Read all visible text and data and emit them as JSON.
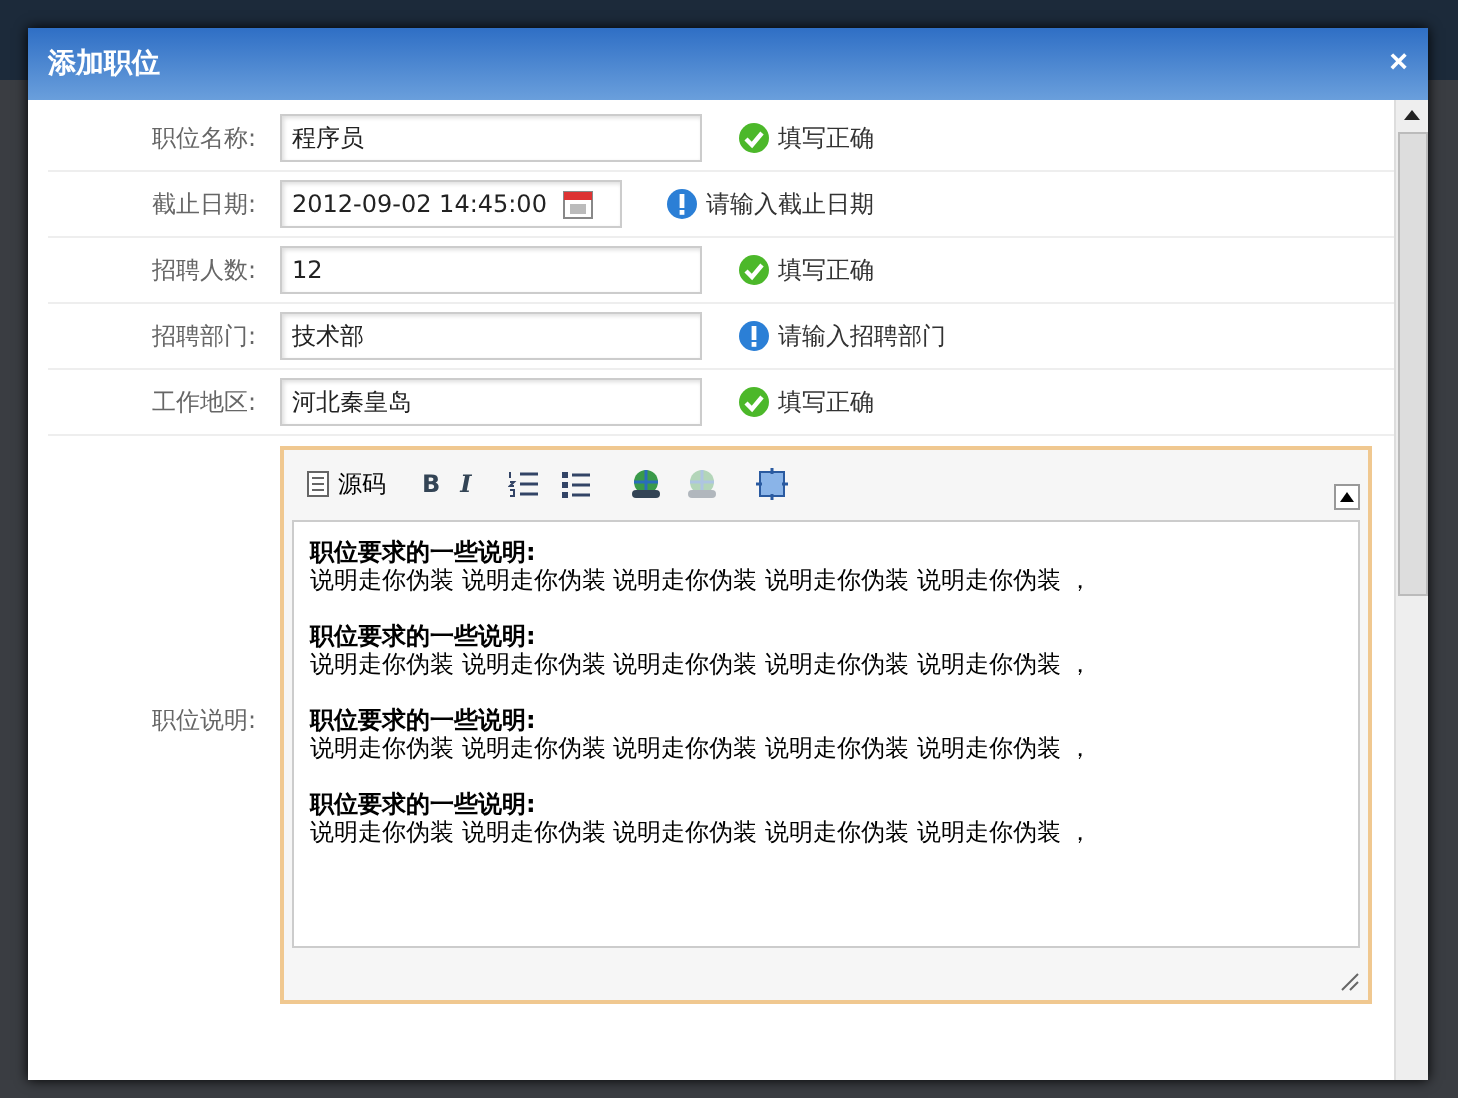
{
  "dialog": {
    "title": "添加职位",
    "close": "×"
  },
  "fields": [
    {
      "label": "职位名称:",
      "value": "程序员",
      "kind": "text",
      "valid": true,
      "message": "填写正确"
    },
    {
      "label": "截止日期:",
      "value": "2012-09-02 14:45:00",
      "kind": "date",
      "valid": false,
      "message": "请输入截止日期"
    },
    {
      "label": "招聘人数:",
      "value": "12",
      "kind": "text",
      "valid": true,
      "message": "填写正确"
    },
    {
      "label": "招聘部门:",
      "value": "技术部",
      "kind": "text",
      "valid": false,
      "message": "请输入招聘部门"
    },
    {
      "label": "工作地区:",
      "value": "河北秦皇岛",
      "kind": "text",
      "valid": true,
      "message": "填写正确"
    }
  ],
  "editor": {
    "label": "职位说明:",
    "toolbar": [
      {
        "kind": "source",
        "text": "源码",
        "disabled": false
      },
      {
        "kind": "bold",
        "text": "B",
        "disabled": false
      },
      {
        "kind": "italic",
        "text": "I",
        "disabled": false
      },
      {
        "kind": "ordered-list",
        "disabled": false
      },
      {
        "kind": "bullet-list",
        "disabled": false
      },
      {
        "kind": "link",
        "disabled": false
      },
      {
        "kind": "unlink",
        "disabled": true
      },
      {
        "kind": "maximize",
        "disabled": false
      }
    ],
    "paragraphs": [
      {
        "heading": "职位要求的一些说明:",
        "text": "说明走你伪装 说明走你伪装 说明走你伪装 说明走你伪装 说明走你伪装 ，"
      },
      {
        "heading": "职位要求的一些说明:",
        "text": "说明走你伪装 说明走你伪装 说明走你伪装 说明走你伪装 说明走你伪装 ，"
      },
      {
        "heading": "职位要求的一些说明:",
        "text": "说明走你伪装 说明走你伪装 说明走你伪装 说明走你伪装 说明走你伪装 ，"
      },
      {
        "heading": "职位要求的一些说明:",
        "text": "说明走你伪装 说明走你伪装 说明走你伪装 说明走你伪装 说明走你伪装 ，"
      }
    ]
  }
}
